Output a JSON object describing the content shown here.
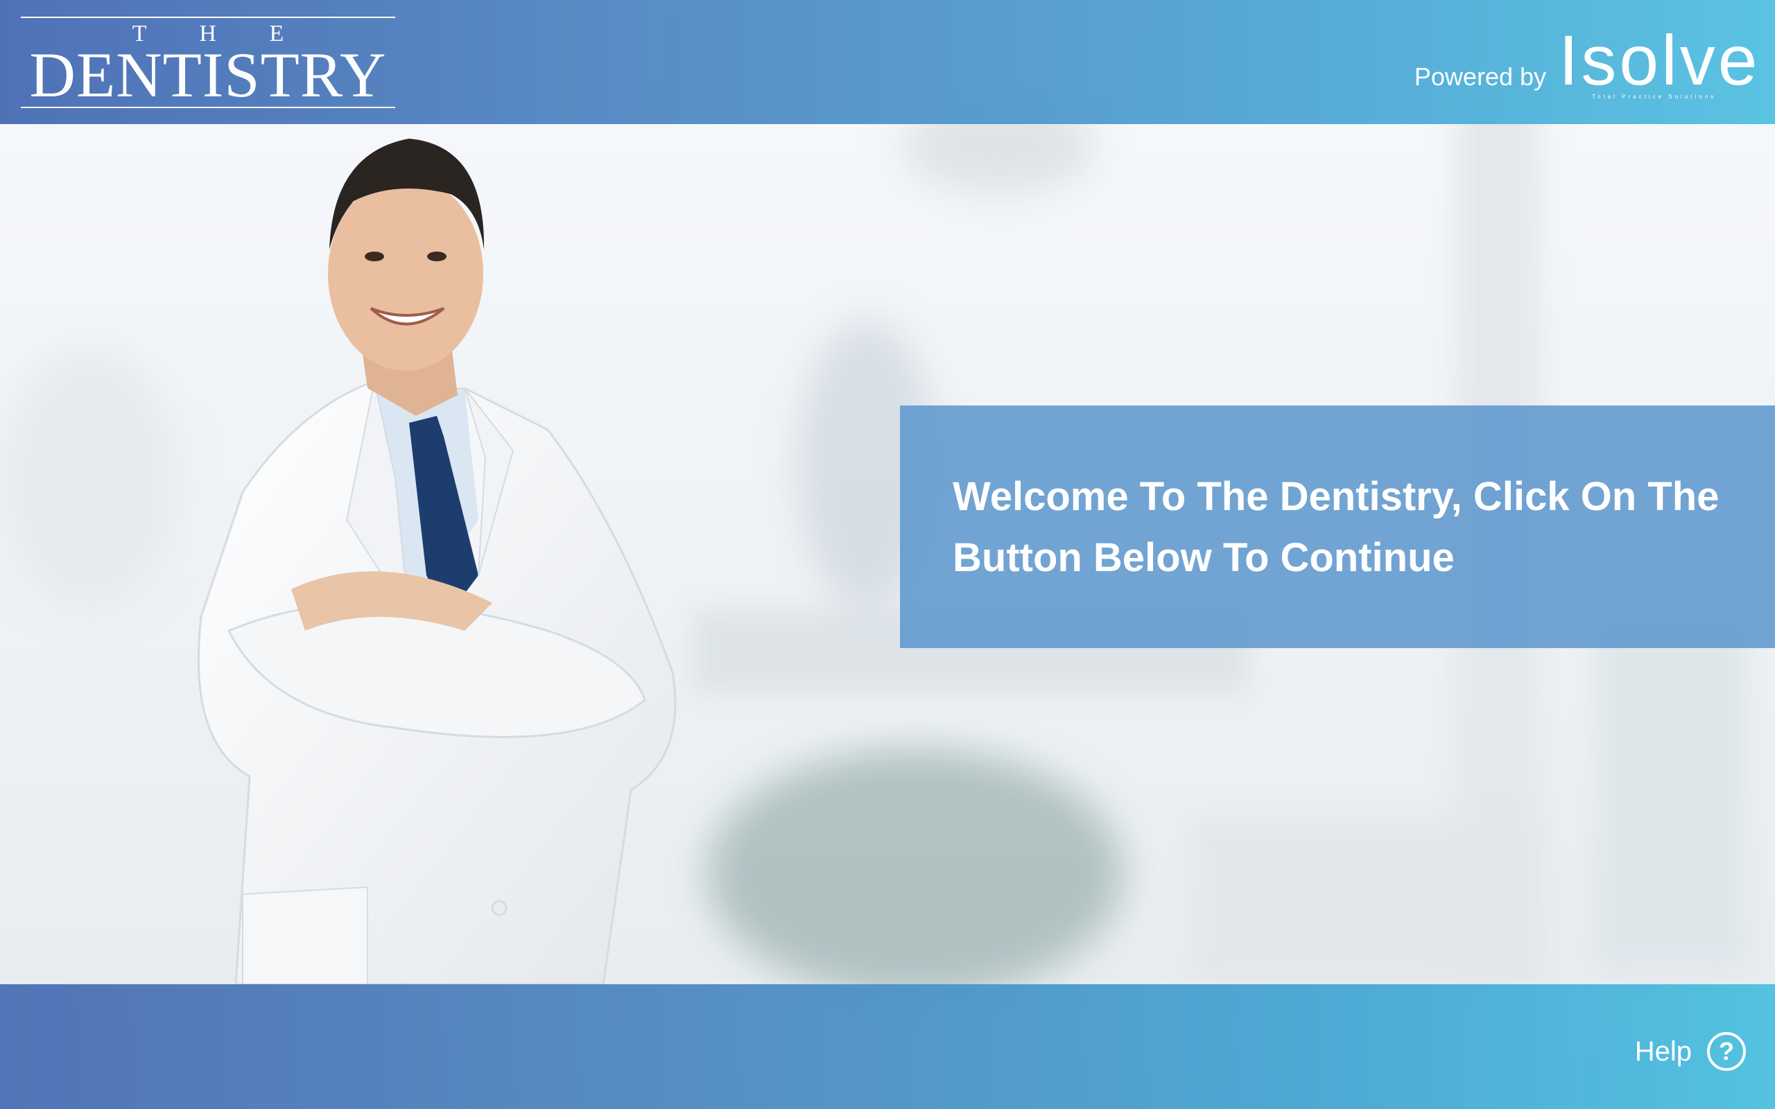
{
  "header": {
    "logo": {
      "top_word": "T H E",
      "main_word": "DENTISTRY"
    },
    "powered_by": "Powered by",
    "brand": {
      "name": "Isolve",
      "tagline": "Total Practice Solutions"
    }
  },
  "welcome": {
    "message": "Welcome To The Dentistry, Click On The Button Below To Continue"
  },
  "footer": {
    "help_label": "Help",
    "help_icon": "question-circle-icon"
  },
  "colors": {
    "header_start": "#4a6eb5",
    "header_end": "#55c2e2",
    "panel": "#5c96cd",
    "text": "#ffffff"
  }
}
